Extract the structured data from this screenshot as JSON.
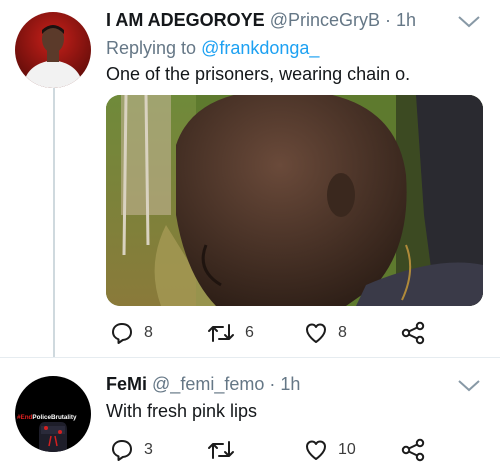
{
  "tweets": [
    {
      "display_name": "I AM ADEGOROYE",
      "handle": "@PrinceGryB",
      "separator": "·",
      "time": "1h",
      "replying_prefix": "Replying to",
      "replying_to": "@frankdonga_",
      "text": "One of the prisoners, wearing chain o.",
      "actions": {
        "replies": "8",
        "retweets": "6",
        "likes": "8"
      }
    },
    {
      "display_name": "FeMi",
      "handle": "@_femi_femo",
      "separator": "·",
      "time": "1h",
      "text": "With fresh pink lips",
      "avatar_text": "#EndPoliceBrutality",
      "actions": {
        "replies": "3",
        "retweets": "",
        "likes": "10"
      }
    }
  ],
  "colors": {
    "link": "#1da1f2",
    "muted": "#657786",
    "text": "#14171a",
    "icon": "#1c1c1c"
  }
}
